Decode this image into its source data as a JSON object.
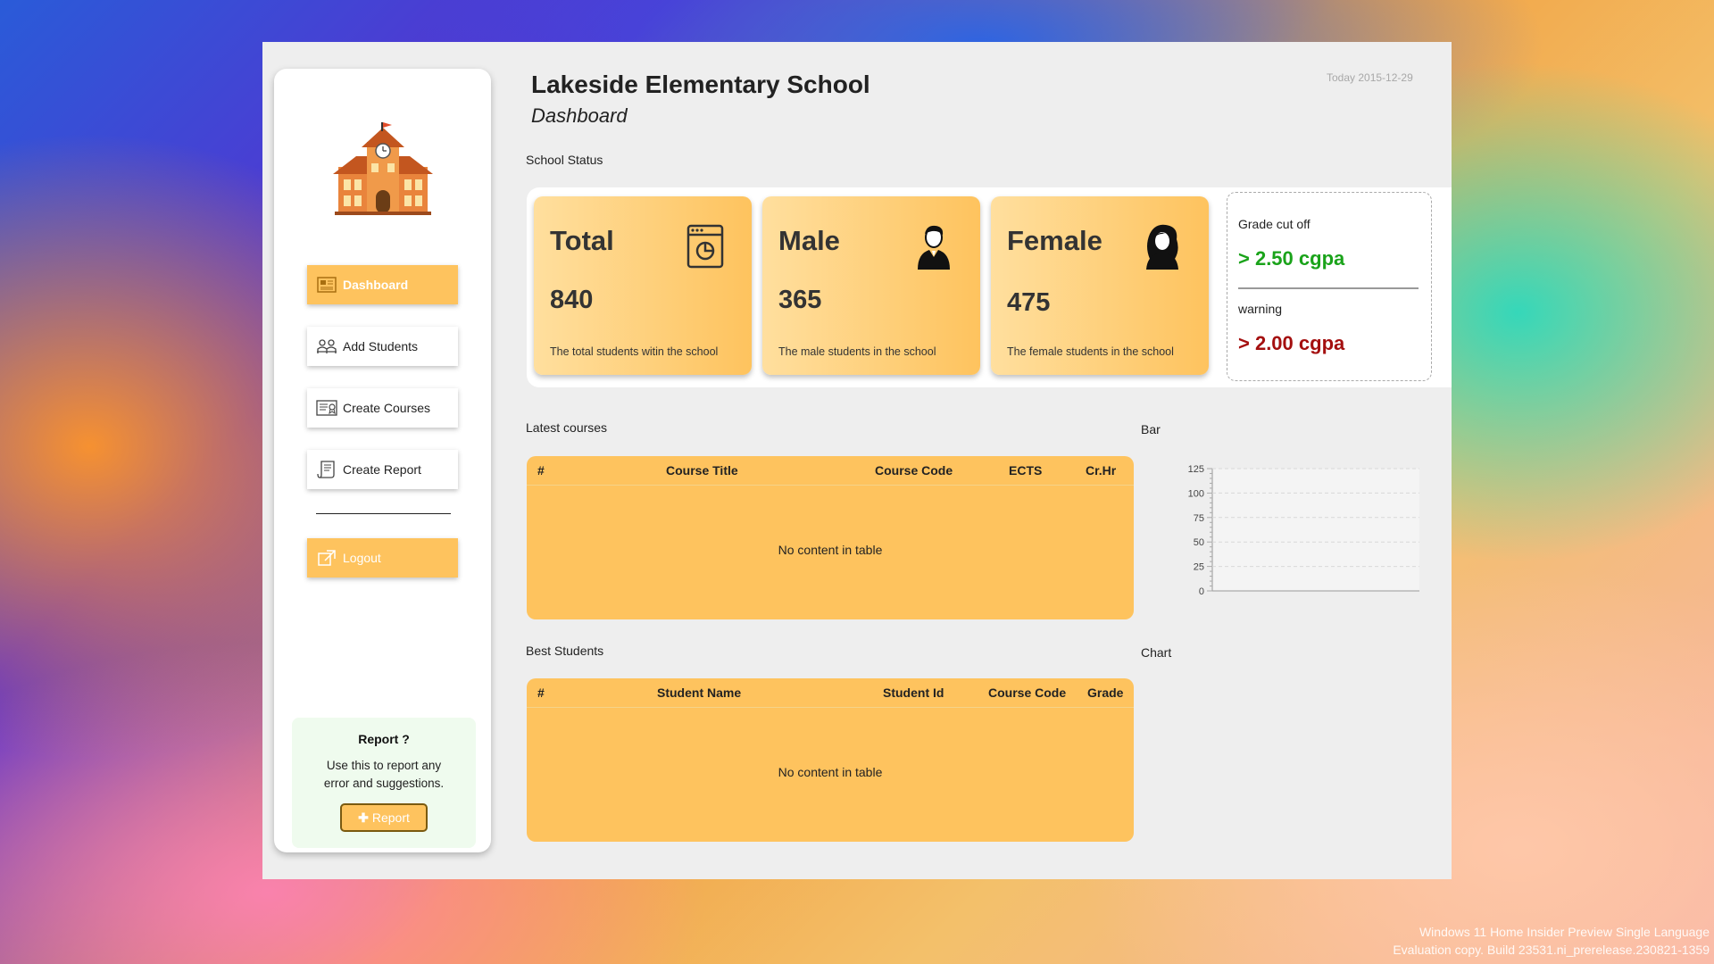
{
  "school": {
    "name": "Lakeside Elementary School",
    "page": "Dashboard",
    "today": "Today 2015-12-29"
  },
  "sidebar": {
    "items": [
      {
        "label": "Dashboard",
        "icon": "dashboard-icon",
        "active": true
      },
      {
        "label": "Add Students",
        "icon": "students-icon"
      },
      {
        "label": "Create Courses",
        "icon": "certificate-icon"
      },
      {
        "label": "Create Report",
        "icon": "report-icon"
      }
    ],
    "logout": "Logout",
    "report": {
      "title": "Report ?",
      "line1": "Use this to report any",
      "line2": "error and suggestions.",
      "button": "Report"
    }
  },
  "status": {
    "label": "School Status",
    "cards": [
      {
        "title": "Total",
        "value": "840",
        "desc": "The total students witin the school",
        "icon": "chart-window-icon"
      },
      {
        "title": "Male",
        "value": "365",
        "desc": "The male students in the school",
        "icon": "male-avatar-icon"
      },
      {
        "title": "Female",
        "value": "475",
        "desc": "The female students in the school",
        "icon": "female-avatar-icon"
      }
    ],
    "grade": {
      "cutoff_label": "Grade cut off",
      "cutoff_value": "> 2.50 cgpa",
      "warning_label": "warning",
      "warning_value": "> 2.00 cgpa"
    }
  },
  "courses": {
    "label": "Latest courses",
    "columns": [
      "#",
      "Course Title",
      "Course Code",
      "ECTS",
      "Cr.Hr"
    ],
    "empty": "No content in table"
  },
  "students": {
    "label": "Best Students",
    "columns": [
      "#",
      "Student Name",
      "Student Id",
      "Course Code",
      "Grade"
    ],
    "empty": "No content in table"
  },
  "bar_label": "Bar",
  "chart_label": "Chart",
  "chart_data": {
    "type": "bar",
    "categories": [],
    "values": [],
    "ylim": [
      0,
      125
    ],
    "yticks": [
      "0",
      "25",
      "50",
      "75",
      "100",
      "125"
    ],
    "grid": true
  },
  "colors": {
    "accent": "#fec35e",
    "green": "#1aa31a",
    "red": "#a40f0f"
  },
  "watermark": {
    "line1": "Windows 11 Home Insider Preview Single Language",
    "line2": "Evaluation copy. Build 23531.ni_prerelease.230821-1359"
  }
}
